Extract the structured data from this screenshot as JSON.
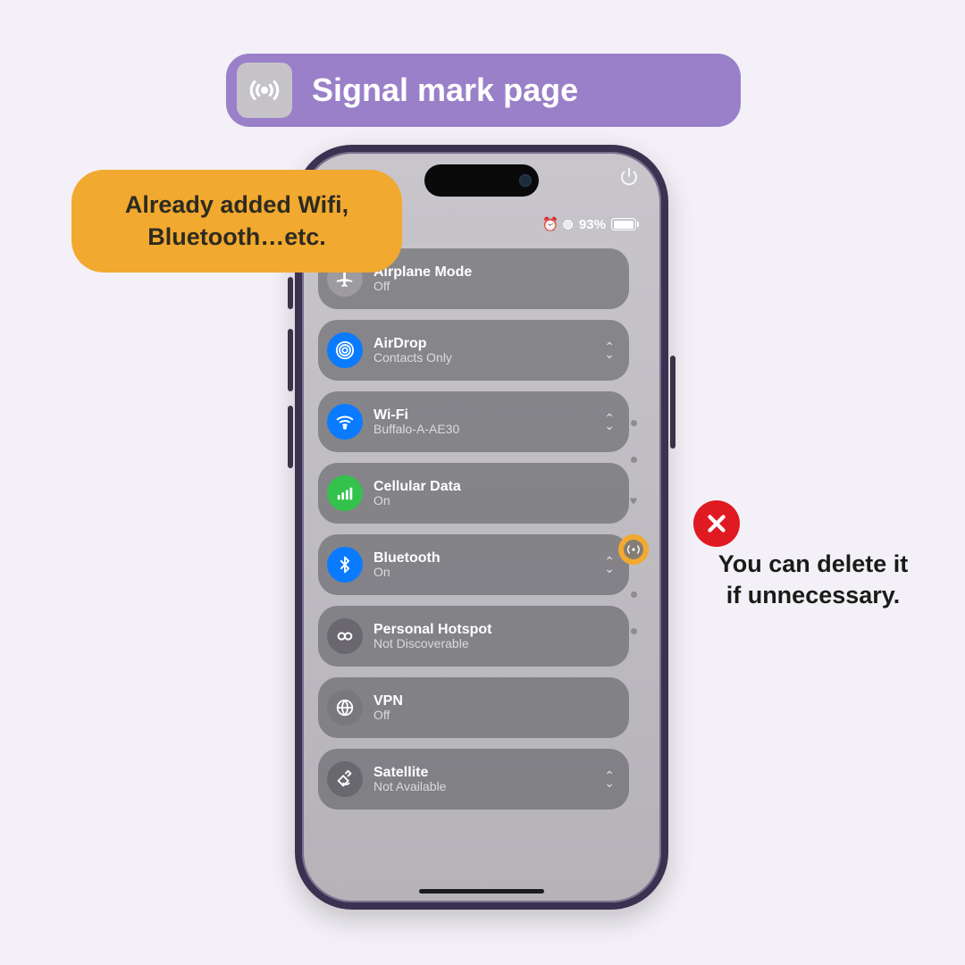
{
  "header": {
    "title": "Signal mark page",
    "icon_name": "antenna-icon"
  },
  "annotations": {
    "added_label": "Already added Wifi,\nBluetooth…etc.",
    "delete_label": "You can delete it\nif unnecessary."
  },
  "status": {
    "battery_text": "93%",
    "indicators": "⏰ ⊚"
  },
  "rows": [
    {
      "id": "airplane",
      "title": "Airplane Mode",
      "sub": "Off",
      "icon": "airplane-icon",
      "color": "grey",
      "chev": false
    },
    {
      "id": "airdrop",
      "title": "AirDrop",
      "sub": "Contacts Only",
      "icon": "airdrop-icon",
      "color": "blue",
      "chev": true
    },
    {
      "id": "wifi",
      "title": "Wi-Fi",
      "sub": "Buffalo-A-AE30",
      "icon": "wifi-icon",
      "color": "blue",
      "chev": true
    },
    {
      "id": "cellular",
      "title": "Cellular Data",
      "sub": "On",
      "icon": "cellular-icon",
      "color": "green",
      "chev": false
    },
    {
      "id": "bluetooth",
      "title": "Bluetooth",
      "sub": "On",
      "icon": "bluetooth-icon",
      "color": "blue",
      "chev": true
    },
    {
      "id": "hotspot",
      "title": "Personal Hotspot",
      "sub": "Not Discoverable",
      "icon": "hotspot-icon",
      "color": "dark",
      "chev": false
    },
    {
      "id": "vpn",
      "title": "VPN",
      "sub": "Off",
      "icon": "vpn-icon",
      "color": "dim",
      "chev": false
    },
    {
      "id": "satellite",
      "title": "Satellite",
      "sub": "Not Available",
      "icon": "satellite-icon",
      "color": "dark",
      "chev": true
    }
  ],
  "colors": {
    "header_bg": "#9a80c9",
    "orange": "#f2a92f",
    "red": "#e01a22"
  }
}
